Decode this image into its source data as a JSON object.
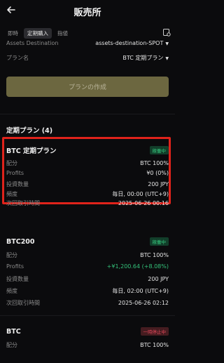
{
  "header": {
    "title": "販売所"
  },
  "tabs": [
    {
      "label": "即時"
    },
    {
      "label": "定期購入"
    },
    {
      "label": "指値"
    }
  ],
  "form": {
    "assets_destination_label": "Assets Destination",
    "assets_destination_value": "assets-destination-SPOT",
    "plan_name_label": "プラン名",
    "plan_name_value": "BTC 定期プラン",
    "create_button": "プランの作成"
  },
  "plans_section": {
    "title": "定期プラン (4)"
  },
  "plans": [
    {
      "name": "BTC 定期プラン",
      "status": "稼働中",
      "allocation_label": "配分",
      "allocation_value": "BTC 100%",
      "profits_label": "Profits",
      "profits_value": "¥0 (0%)",
      "amount_label": "投資数量",
      "amount_value": "200 JPY",
      "frequency_label": "頻度",
      "frequency_value": "毎日, 00:00 (UTC+9)",
      "next_label": "次回取引時間",
      "next_value": "2025-06-26 00:16"
    },
    {
      "name": "BTC200",
      "status": "稼働中",
      "allocation_label": "配分",
      "allocation_value": "BTC 100%",
      "profits_label": "Profits",
      "profits_value": "+¥1,200.64 (+8.08%)",
      "amount_label": "投資数量",
      "amount_value": "200 JPY",
      "frequency_label": "頻度",
      "frequency_value": "毎日, 02:00 (UTC+9)",
      "next_label": "次回取引時間",
      "next_value": "2025-06-26 02:12"
    },
    {
      "name": "BTC",
      "status": "一時停止中",
      "allocation_label": "配分",
      "allocation_value": "BTC 100%"
    }
  ],
  "colors": {
    "accent": "#6c6740",
    "active_green": "#34c27a",
    "paused_red": "#e0475a",
    "highlight": "#e0231b"
  }
}
